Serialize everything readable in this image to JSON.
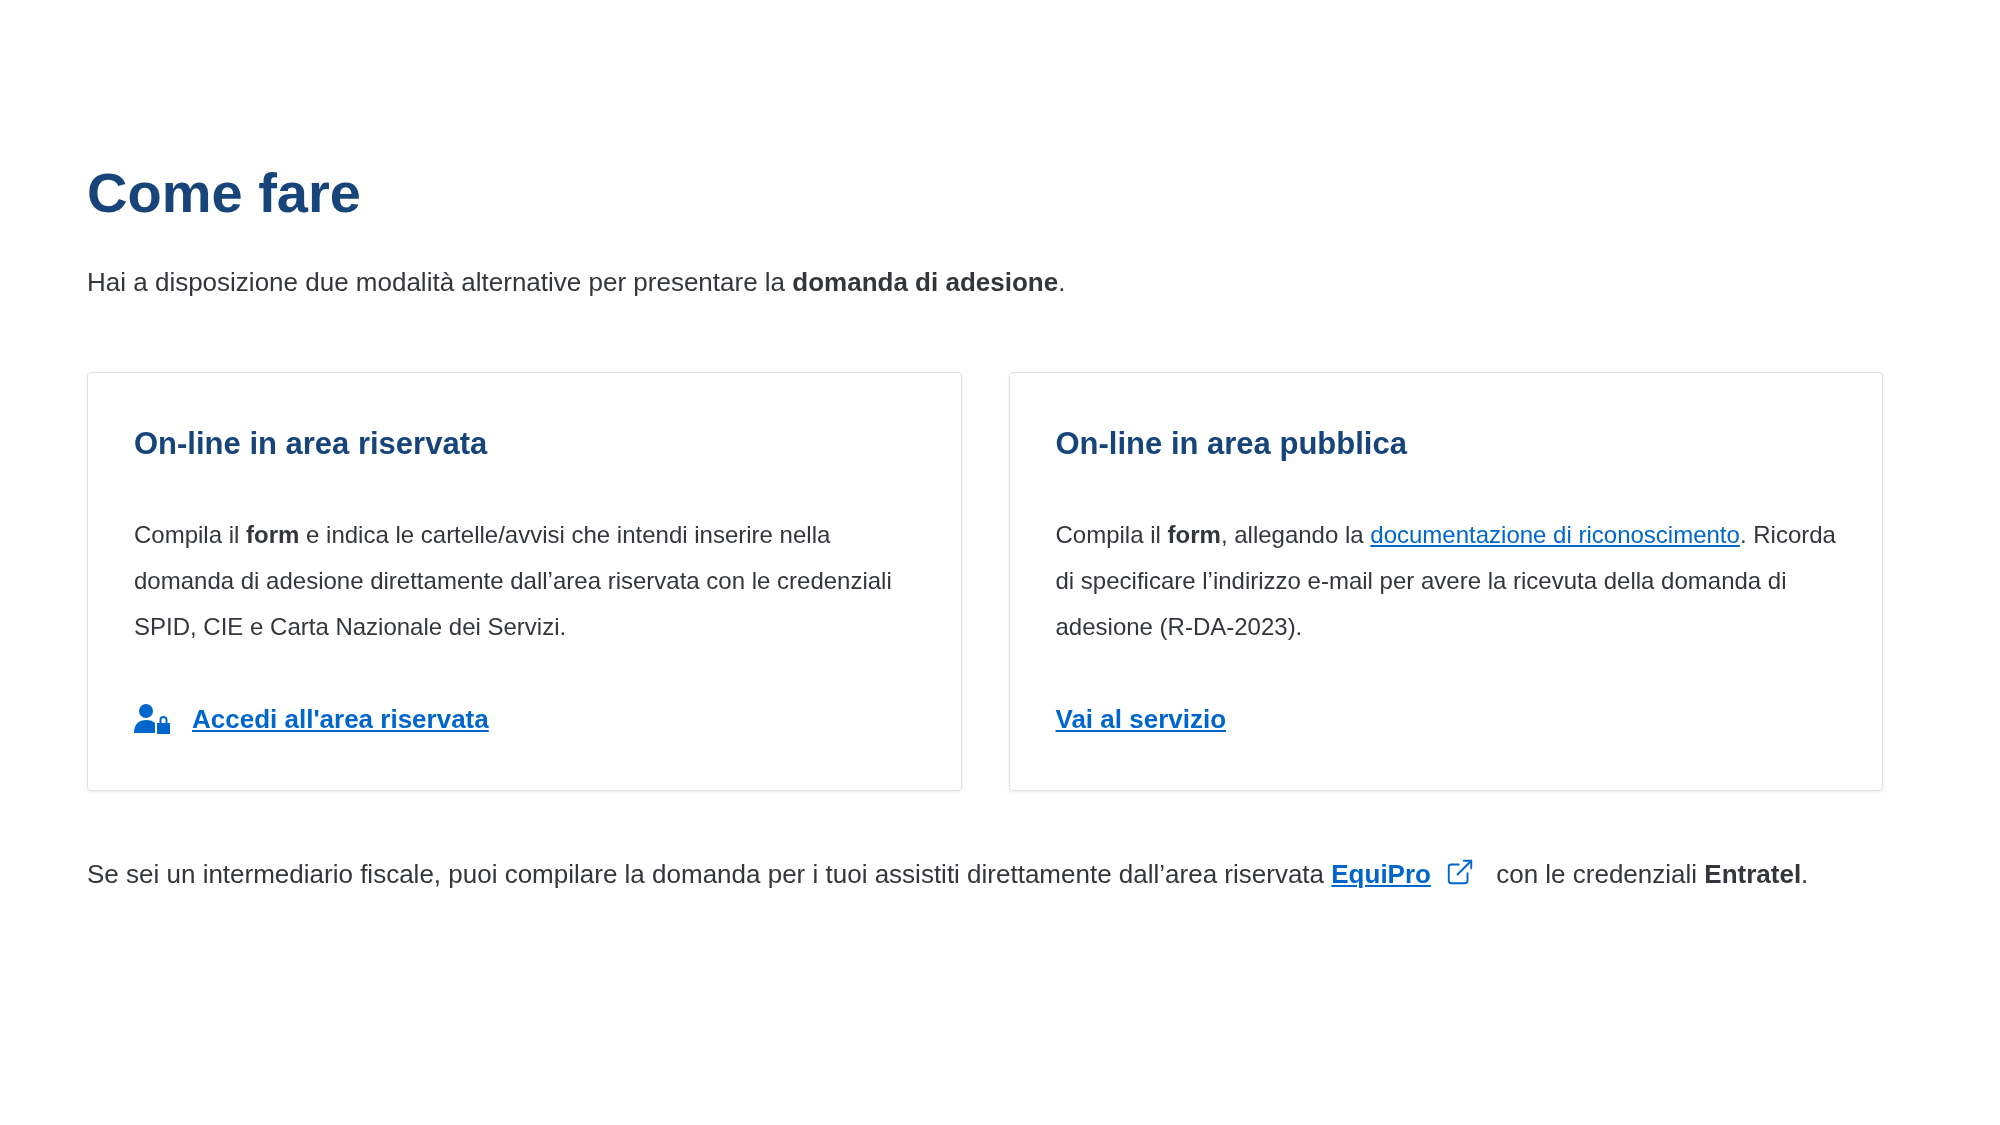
{
  "heading": "Come fare",
  "intro": "Hai a disposizione due modalità alternative per presentare la **domanda di adesione**.",
  "cards": [
    {
      "title": "On-line in area riservata",
      "body": [
        {
          "kind": "text",
          "text": "Compila il **form** e indica le cartelle/avvisi che intendi inserire nella domanda di adesione direttamente dall’area riservata con le credenziali SPID, CIE e Carta Nazionale dei Servizi."
        }
      ],
      "link": {
        "label": "Accedi all'area riservata",
        "kind": "account"
      }
    },
    {
      "title": "On-line in area pubblica",
      "body": [
        {
          "kind": "text",
          "text": "Compila il **form**, allegando la "
        },
        {
          "kind": "link",
          "text": "documentazione di riconoscimento"
        },
        {
          "kind": "text",
          "text": ". Ricorda di specificare l’indirizzo e-mail per avere la ricevuta della domanda di adesione (R-DA-2023)."
        }
      ],
      "link": {
        "label": "Vai al servizio",
        "kind": "plain"
      }
    }
  ],
  "footer": [
    {
      "kind": "text",
      "text": "Se sei un intermediario fiscale, puoi compilare la domanda per i tuoi assistiti direttamente dall’area riservata "
    },
    {
      "kind": "external_link",
      "text": "EquiPro"
    },
    {
      "kind": "text",
      "text": " con le credenziali **Entratel**."
    }
  ]
}
